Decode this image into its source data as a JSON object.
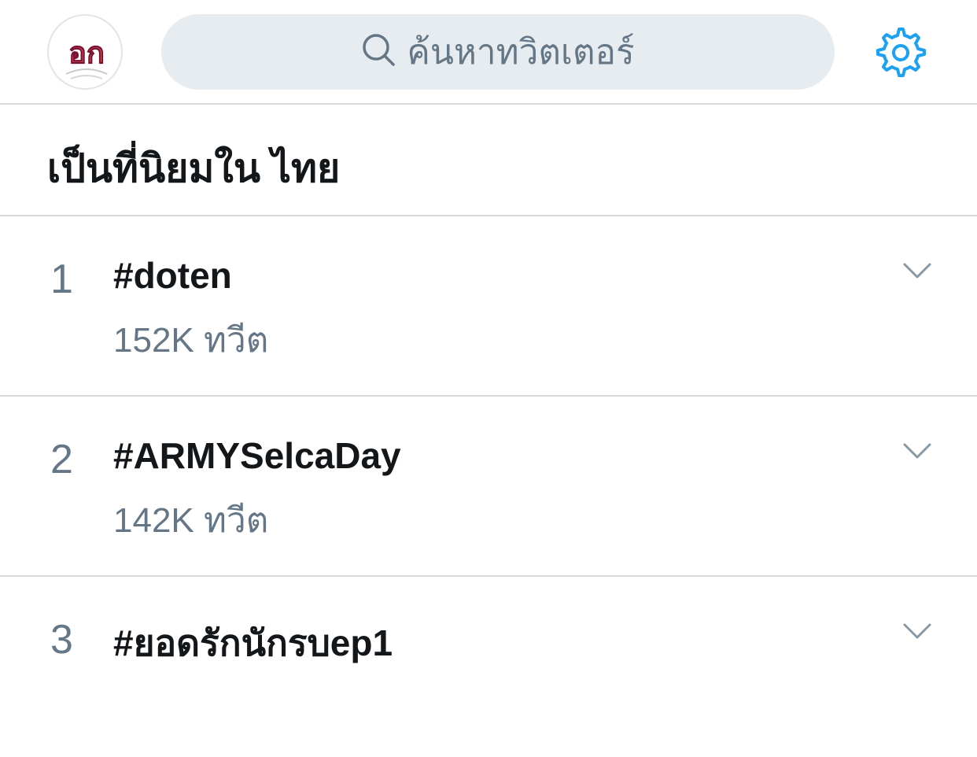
{
  "header": {
    "avatar_label": "อก",
    "search_placeholder": "ค้นหาทวิตเตอร์"
  },
  "section": {
    "title": "เป็นที่นิยมใน ไทย"
  },
  "trends": [
    {
      "rank": "1",
      "name": "#doten",
      "count": "152K ทวีต"
    },
    {
      "rank": "2",
      "name": "#ARMYSelcaDay",
      "count": "142K ทวีต"
    },
    {
      "rank": "3",
      "name": "#ยอดรักนักรบep1",
      "count": ""
    }
  ],
  "colors": {
    "accent": "#1da1f2",
    "secondary_text": "#657786",
    "search_bg": "#e6ecf0",
    "divider": "#d6d9dc"
  },
  "icons": {
    "search": "search-icon",
    "settings": "gear-icon",
    "expand": "chevron-down-icon"
  }
}
